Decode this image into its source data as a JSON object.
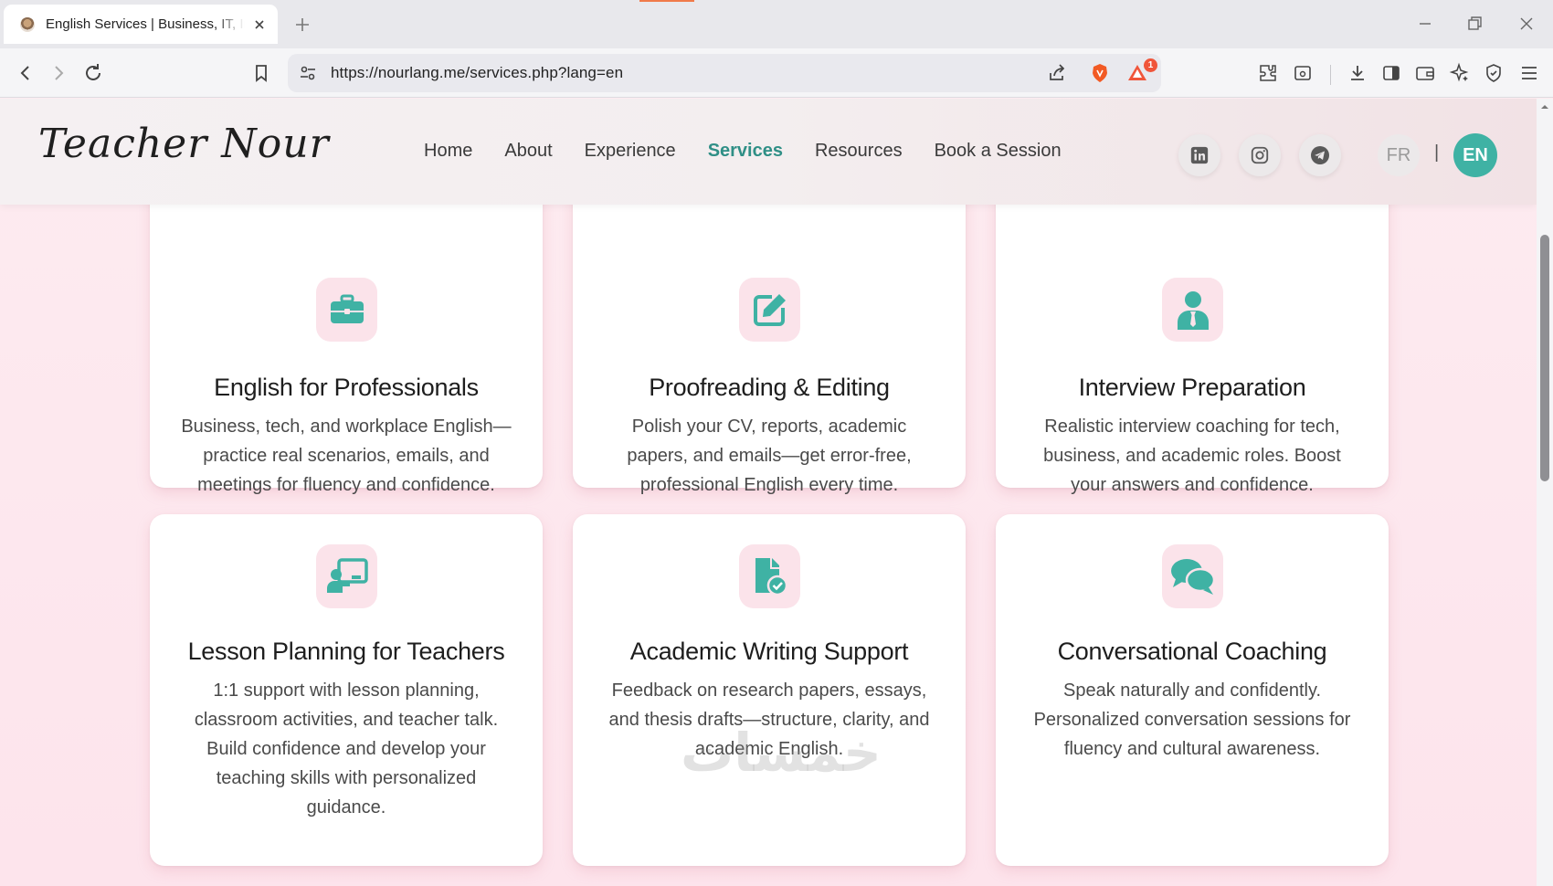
{
  "browser": {
    "tab_title": "English Services | Business, IT, Interview",
    "url": "https://nourlang.me/services.php?lang=en",
    "notification_count": "1"
  },
  "site": {
    "logo": "Teacher Nour",
    "nav": [
      {
        "label": "Home"
      },
      {
        "label": "About"
      },
      {
        "label": "Experience"
      },
      {
        "label": "Services",
        "active": true
      },
      {
        "label": "Resources"
      },
      {
        "label": "Book a Session"
      }
    ],
    "languages": {
      "fr": "FR",
      "separator": "|",
      "en": "EN"
    },
    "accent_color": "#3fb2a4"
  },
  "services": [
    {
      "icon": "briefcase-icon",
      "title": "English for Professionals",
      "description": "Business, tech, and workplace English—practice real scenarios, emails, and meetings for fluency and confidence."
    },
    {
      "icon": "edit-icon",
      "title": "Proofreading & Editing",
      "description": "Polish your CV, reports, academic papers, and emails—get error-free, professional English every time."
    },
    {
      "icon": "user-tie-icon",
      "title": "Interview Preparation",
      "description": "Realistic interview coaching for tech, business, and academic roles. Boost your answers and confidence."
    },
    {
      "icon": "chalkboard-teacher-icon",
      "title": "Lesson Planning for Teachers",
      "description": "1:1 support with lesson planning, classroom activities, and teacher talk. Build confidence and develop your teaching skills with personalized guidance."
    },
    {
      "icon": "file-check-icon",
      "title": "Academic Writing Support",
      "description": "Feedback on research papers, essays, and thesis drafts—structure, clarity, and academic English."
    },
    {
      "icon": "comments-icon",
      "title": "Conversational Coaching",
      "description": "Speak naturally and confidently. Personalized conversation sessions for fluency and cultural awareness."
    }
  ],
  "watermark": "خمسات"
}
